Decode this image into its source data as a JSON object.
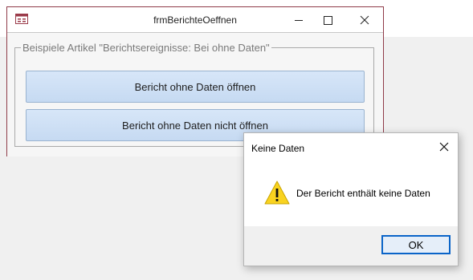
{
  "form": {
    "title": "frmBerichteOeffnen",
    "group_label": "Beispiele Artikel \"Berichtsereignisse: Bei ohne Daten\"",
    "buttons": [
      {
        "label": "Bericht ohne Daten öffnen"
      },
      {
        "label": "Bericht ohne Daten nicht öffnen"
      }
    ]
  },
  "msgbox": {
    "title": "Keine Daten",
    "text": "Der Bericht enthält keine Daten",
    "ok_label": "OK",
    "icon": "warning-icon"
  },
  "colors": {
    "window_border": "#8f3a48",
    "button_bg": "#d7e6f8",
    "button_border": "#9ab3d0",
    "ok_border": "#0a64c8",
    "warning_yellow": "#f9d320"
  }
}
